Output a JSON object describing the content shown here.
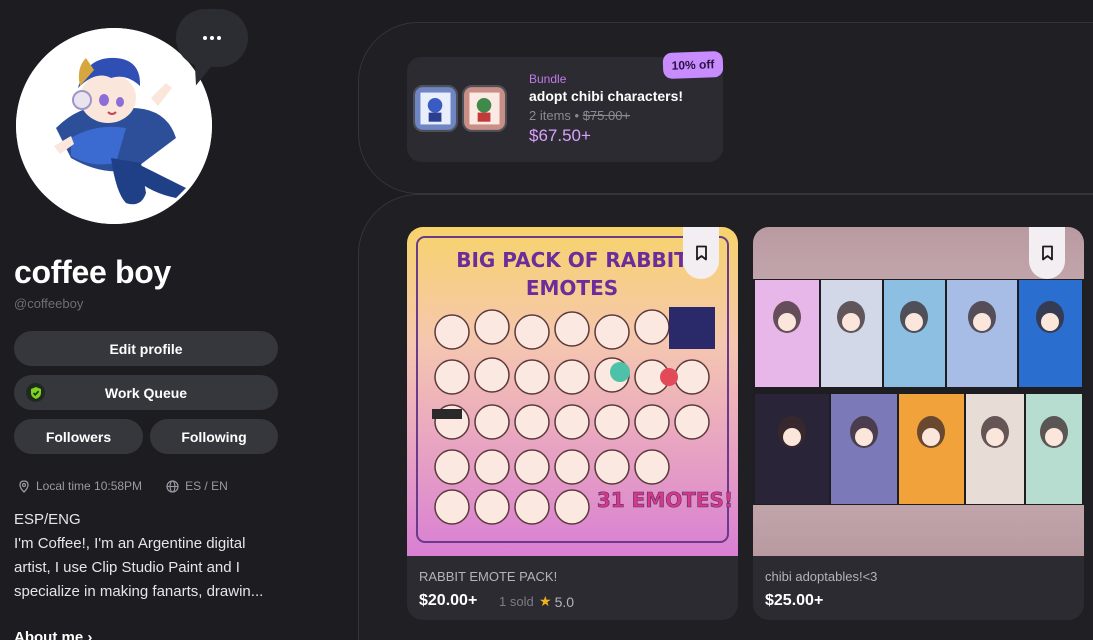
{
  "profile": {
    "display_name": "coffee boy",
    "handle": "@coffeeboy",
    "more_glyph": "•••",
    "buttons": {
      "edit_profile": "Edit profile",
      "work_queue": "Work Queue",
      "followers": "Followers",
      "following": "Following"
    },
    "local_time": "Local time 10:58PM",
    "languages": "ES / EN",
    "bio_lines": [
      "ESP/ENG",
      "I'm Coffee!, I'm an Argentine digital artist, I use Clip Studio Paint and I specialize in making fanarts, drawin..."
    ],
    "about_link": "About me ›"
  },
  "bundle": {
    "label": "Bundle",
    "title": "adopt chibi characters!",
    "items_text": "2 items • ",
    "original_price": "$75.00+",
    "price": "$67.50+",
    "discount": "10% off"
  },
  "products": [
    {
      "title": "RABBIT EMOTE PACK!",
      "price": "$20.00+",
      "sold": "1 sold",
      "rating": "5.0",
      "image_heading_1": "BIG PACK OF RABBIT",
      "image_heading_2": "EMOTES",
      "image_badge": "31 EMOTES!"
    },
    {
      "title": "chibi adoptables!<3",
      "price": "$25.00+"
    }
  ],
  "colors": {
    "background": "#1c1c21",
    "accent_purple": "#c88cff",
    "bundle_price": "#d9a2ff",
    "star": "#f2b21c",
    "queue_badge": "#7ed321"
  },
  "icons": [
    "more-dots-icon",
    "shield-check-icon",
    "location-pin-icon",
    "globe-icon",
    "bookmark-icon",
    "star-icon"
  ]
}
